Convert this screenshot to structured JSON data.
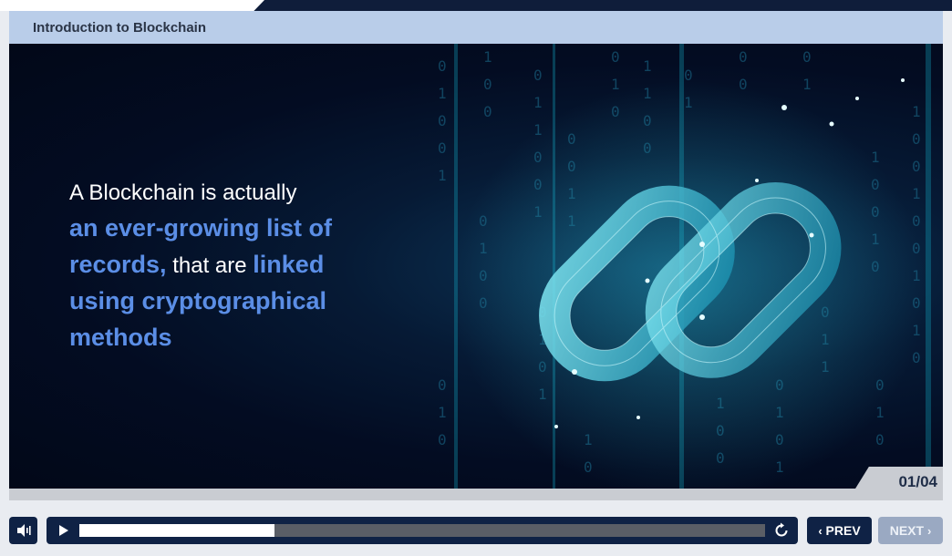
{
  "course": {
    "title": "Introduction to Blockchain"
  },
  "slide": {
    "text_intro": "A Blockchain is actually",
    "text_hl1": "an ever-growing list of records,",
    "text_mid": " that are ",
    "text_hl2": "linked using cryptographical methods",
    "counter": "01/04"
  },
  "player": {
    "progress": 0.285
  },
  "nav": {
    "prev_label": "PREV",
    "next_label": "NEXT"
  },
  "icons": {
    "volume": "volume-icon",
    "play": "play-icon",
    "replay": "replay-icon",
    "prev": "chevron-left-icon",
    "next": "chevron-right-icon",
    "chain": "chain-link-illustration"
  },
  "colors": {
    "header_bg": "#b9cde9",
    "dark_navy": "#0f2245",
    "highlight_blue": "#5b8ee6",
    "next_disabled": "#9aa9c2"
  }
}
